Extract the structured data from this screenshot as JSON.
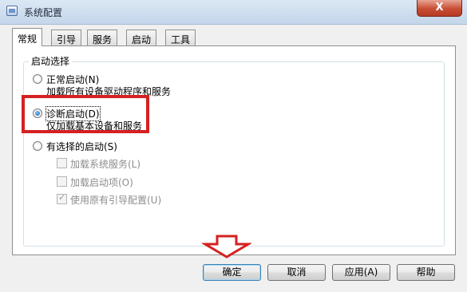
{
  "window": {
    "title": "系统配置",
    "close_label": "X"
  },
  "tabs": [
    {
      "label": "常规",
      "active": true
    },
    {
      "label": "引导",
      "active": false
    },
    {
      "label": "服务",
      "active": false
    },
    {
      "label": "启动",
      "active": false
    },
    {
      "label": "工具",
      "active": false
    }
  ],
  "startup_selection": {
    "group_title": "启动选择",
    "normal": {
      "label": "正常启动(N)",
      "description": "加载所有设备驱动程序和服务",
      "selected": false
    },
    "diagnostic": {
      "label": "诊断启动(D)",
      "description": "仅加载基本设备和服务",
      "selected": true
    },
    "selective": {
      "label": "有选择的启动(S)",
      "selected": false,
      "options": [
        {
          "label": "加载系统服务(L)",
          "checked": false
        },
        {
          "label": "加载启动项(O)",
          "checked": false
        },
        {
          "label": "使用原有引导配置(U)",
          "checked": true
        }
      ]
    }
  },
  "buttons": {
    "ok": "确定",
    "cancel": "取消",
    "apply": "应用(A)",
    "help": "帮助"
  },
  "annotations": {
    "highlight_color": "#d42121",
    "arrow_color": "#d42121"
  }
}
